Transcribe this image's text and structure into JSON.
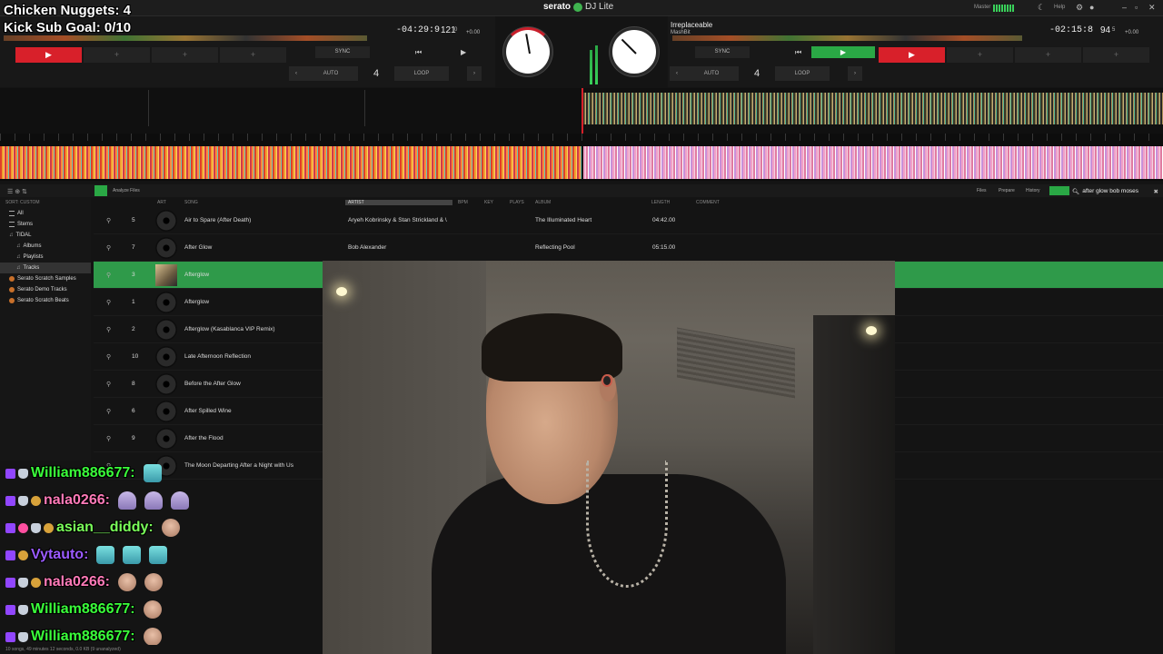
{
  "overlay": {
    "nuggets": "Chicken Nuggets: 4",
    "kick_goal": "Kick Sub Goal: 0/10"
  },
  "app": {
    "brand": "serato",
    "edition": "DJ Lite",
    "master_label": "Master",
    "help_label": "Help"
  },
  "deck_left": {
    "time_remaining": "-04:29:9",
    "bpm": "121",
    "bpm_decimal": "0",
    "pitch": "+0.00",
    "sync_label": "SYNC",
    "auto_label": "AUTO",
    "loop_label": "LOOP",
    "loop_size": "4",
    "play_icon": "play-icon",
    "accent": "#d8202a"
  },
  "deck_right": {
    "title": "Irreplaceable",
    "artist": "MashBit",
    "time_remaining": "-02:15:8",
    "bpm": "94",
    "bpm_decimal": "5",
    "pitch": "+0.00",
    "sync_label": "SYNC",
    "auto_label": "AUTO",
    "loop_label": "LOOP",
    "loop_size": "4",
    "accent": "#2aa845"
  },
  "library": {
    "analyze_label": "Analyze Files",
    "sort_label": "SORT: CUSTOM",
    "tabs": [
      "Files",
      "Prepare",
      "History"
    ],
    "search_value": "after glow bob moses",
    "columns": {
      "art": "ART",
      "song": "SONG",
      "artist": "ARTIST",
      "bpm": "BPM",
      "key": "KEY",
      "plays": "PLAYS",
      "album": "ALBUM",
      "length": "LENGTH",
      "comment": "COMMENT"
    },
    "sidebar": [
      {
        "label": "All",
        "indent": 1,
        "icon": "list-icon"
      },
      {
        "label": "Stems",
        "indent": 1,
        "icon": "list-icon"
      },
      {
        "label": "TIDAL",
        "indent": 1,
        "icon": "note-icon"
      },
      {
        "label": "Albums",
        "indent": 2,
        "icon": "note-icon"
      },
      {
        "label": "Playlists",
        "indent": 2,
        "icon": "note-icon"
      },
      {
        "label": "Tracks",
        "indent": 2,
        "icon": "note-icon",
        "active": true
      },
      {
        "label": "Serato Scratch Samples",
        "indent": 1,
        "icon": "crate-icon"
      },
      {
        "label": "Serato Demo Tracks",
        "indent": 1,
        "icon": "crate-icon"
      },
      {
        "label": "Serato Scratch Beats",
        "indent": 1,
        "icon": "crate-icon"
      }
    ],
    "rows": [
      {
        "num": "5",
        "song": "Air to Spare (After Death)",
        "artist": "Aryeh Kobrinsky & Stan Strickland & \\",
        "album": "The Illuminated Heart",
        "length": "04:42.00"
      },
      {
        "num": "7",
        "song": "After Glow",
        "artist": "Bob Alexander",
        "album": "Reflecting Pool",
        "length": "05:15.00"
      },
      {
        "num": "3",
        "song": "Afterglow",
        "artist": "",
        "album": "",
        "length": "",
        "selected": true
      },
      {
        "num": "1",
        "song": "Afterglow",
        "artist": "",
        "album": "",
        "length": ""
      },
      {
        "num": "2",
        "song": "Afterglow (Kasablanca VIP Remix)",
        "artist": "",
        "album": "",
        "length": ""
      },
      {
        "num": "10",
        "song": "Late Afternoon Reflection",
        "artist": "",
        "album": "",
        "length": ""
      },
      {
        "num": "8",
        "song": "Before the After Glow",
        "artist": "",
        "album": "",
        "length": ""
      },
      {
        "num": "6",
        "song": "After Spilled Wine",
        "artist": "",
        "album": "",
        "length": ""
      },
      {
        "num": "9",
        "song": "After the Flood",
        "artist": "",
        "album": "",
        "length": ""
      },
      {
        "num": "",
        "song": "The Moon Departing After a Night with Us",
        "artist": "",
        "album": "",
        "length": ""
      }
    ],
    "status": "10 songs, 49 minutes 12 seconds, 0.0 KB (9 unanalyzed)"
  },
  "chat": [
    {
      "name": "William886677:",
      "color": "#3aff3a",
      "badges": [
        "b-purple",
        "b-gray"
      ],
      "emotes": [
        "e-bar"
      ]
    },
    {
      "name": "nala0266:",
      "color": "#ff7ab8",
      "badges": [
        "b-purple",
        "b-gray",
        "b-gold"
      ],
      "emotes": [
        "e-fig",
        "e-fig",
        "e-fig"
      ]
    },
    {
      "name": "asian__diddy:",
      "color": "#7aff5a",
      "badges": [
        "b-purple",
        "b-pink",
        "b-gray",
        "b-gold"
      ],
      "emotes": [
        "e-face"
      ]
    },
    {
      "name": "Vytauto:",
      "color": "#9a5aff",
      "badges": [
        "b-purple",
        "b-gold"
      ],
      "emotes": [
        "e-bar",
        "e-bar",
        "e-bar"
      ]
    },
    {
      "name": "nala0266:",
      "color": "#ff7ab8",
      "badges": [
        "b-purple",
        "b-gray",
        "b-gold"
      ],
      "emotes": [
        "e-face",
        "e-face"
      ]
    },
    {
      "name": "William886677:",
      "color": "#3aff3a",
      "badges": [
        "b-purple",
        "b-gray"
      ],
      "emotes": [
        "e-face"
      ]
    },
    {
      "name": "William886677:",
      "color": "#3aff3a",
      "badges": [
        "b-purple",
        "b-gray"
      ],
      "emotes": [
        "e-face"
      ]
    }
  ]
}
